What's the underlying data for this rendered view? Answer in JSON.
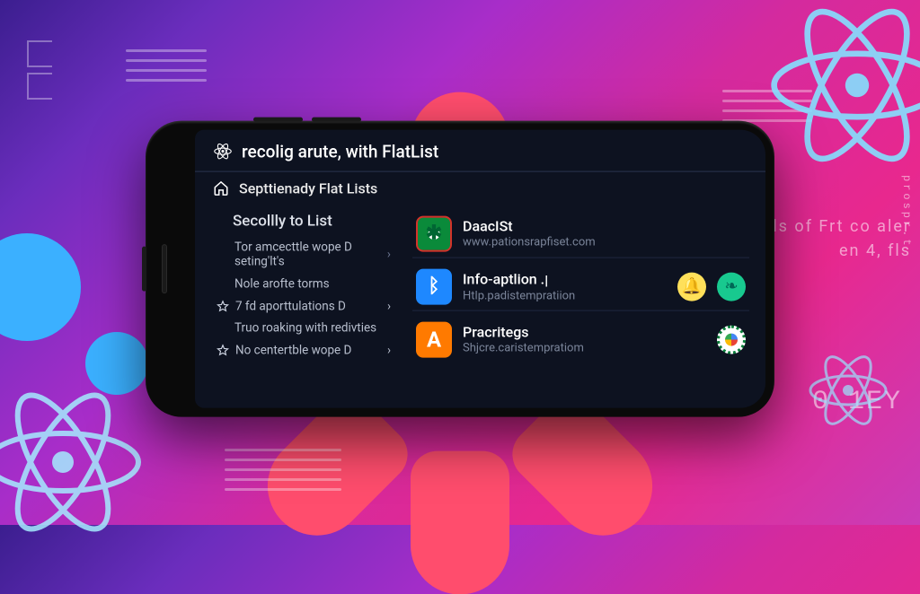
{
  "header": {
    "title": "recolig arute, with FlatList"
  },
  "subheader": {
    "title": "Septtienady Flat Lists"
  },
  "sidebar": {
    "section_title": "Secollly to List",
    "items": [
      {
        "label": "Tor amcecttle wope D seting'lt's"
      },
      {
        "label": "Nole arofte torms"
      },
      {
        "label": "7 fd aporttulations D",
        "starred": true,
        "chev": true
      },
      {
        "label": "Truo roaking with redivties"
      },
      {
        "label": "No centertble wope D",
        "starred": true,
        "chev": true
      }
    ]
  },
  "cards": [
    {
      "icon": "green-circle",
      "name": "DaacISt",
      "sub": "www.pationsrapfiset.com",
      "badges": []
    },
    {
      "icon": "blue-rune",
      "name": "Info-aptlion .ן",
      "sub": "Htlp.padistempratiion",
      "badges": [
        "bell-yellow",
        "leaf-teal"
      ]
    },
    {
      "icon": "orange-a",
      "name": "Pracritegs",
      "sub": "Shjcre.caristempratiom",
      "badges": [
        "google"
      ]
    }
  ],
  "bg_text": {
    "right1a": "ls of Frt co aler",
    "right1b": "en 4, fls",
    "right2": "0 1EY",
    "right3": "prospr.t"
  }
}
